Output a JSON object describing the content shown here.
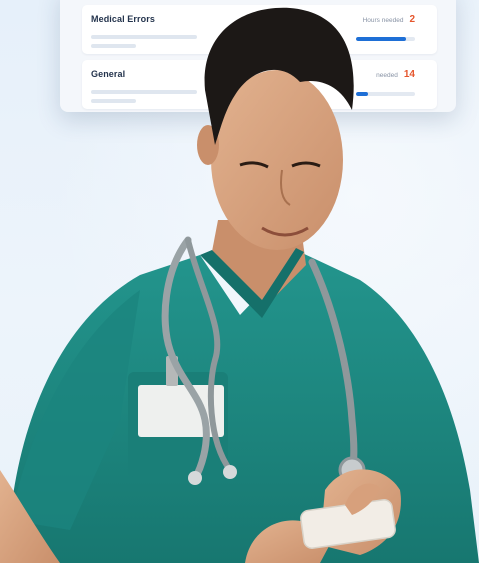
{
  "card": {
    "rows": [
      {
        "title": "Medical Errors",
        "hours_label": "Hours needed",
        "hours_value": "2",
        "progress": 0.85
      },
      {
        "title": "General",
        "hours_label": "needed",
        "hours_value": "14",
        "progress": 0.2
      }
    ]
  },
  "colors": {
    "accent_blue": "#1e6fd6",
    "hours_orange": "#e5562d",
    "scrubs_teal": "#1f8a83",
    "background": "#eaf3fb"
  },
  "icons": {
    "stethoscope": "stethoscope-icon",
    "phone": "smartphone-icon"
  }
}
